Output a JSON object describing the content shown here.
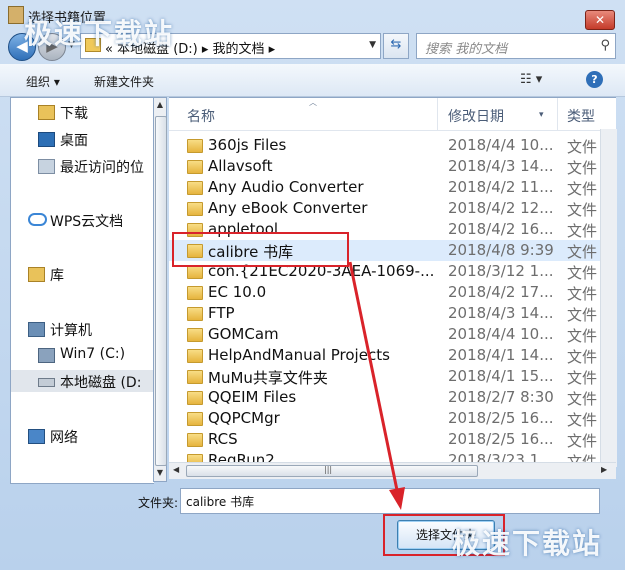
{
  "window": {
    "title": "选择书籍位置",
    "close_glyph": "✕"
  },
  "nav": {
    "back_glyph": "◀",
    "forward_glyph": "▶"
  },
  "address": {
    "crumbs": "« 本地磁盘 (D:) ▸ 我的文档 ▸",
    "dropdown": "▼"
  },
  "search": {
    "placeholder": "搜索 我的文档",
    "icon": "search-icon"
  },
  "toolbar": {
    "organize": "组织 ▾",
    "new_folder": "新建文件夹",
    "view_glyph": "☷ ▾",
    "help_glyph": "?"
  },
  "sidebar": {
    "items": [
      {
        "label": "下载",
        "icon": "download-folder-icon"
      },
      {
        "label": "桌面",
        "icon": "desktop-icon"
      },
      {
        "label": "最近访问的位",
        "icon": "recent-places-icon"
      },
      {
        "label": "WPS云文档",
        "icon": "cloud-icon"
      },
      {
        "label": "库",
        "icon": "library-icon"
      },
      {
        "label": "计算机",
        "icon": "computer-icon"
      },
      {
        "label": "Win7 (C:)",
        "icon": "system-drive-icon"
      },
      {
        "label": "本地磁盘 (D:",
        "icon": "drive-icon"
      },
      {
        "label": "网络",
        "icon": "network-icon"
      }
    ]
  },
  "columns": {
    "name": "名称",
    "date": "修改日期",
    "type": "类型"
  },
  "files": [
    {
      "name": "360js Files",
      "date": "2018/4/4 10...",
      "type": "文件"
    },
    {
      "name": "Allavsoft",
      "date": "2018/4/3 14...",
      "type": "文件"
    },
    {
      "name": "Any Audio Converter",
      "date": "2018/4/2 11...",
      "type": "文件"
    },
    {
      "name": "Any eBook Converter",
      "date": "2018/4/2 12...",
      "type": "文件"
    },
    {
      "name": "appletool",
      "date": "2018/4/2 16...",
      "type": "文件"
    },
    {
      "name": "calibre 书库",
      "date": "2018/4/8 9:39",
      "type": "文件"
    },
    {
      "name": "con.{21EC2020-3AEA-1069-...",
      "date": "2018/3/12 1...",
      "type": "文件"
    },
    {
      "name": "EC 10.0",
      "date": "2018/4/2 17...",
      "type": "文件"
    },
    {
      "name": "FTP",
      "date": "2018/4/3 14...",
      "type": "文件"
    },
    {
      "name": "GOMCam",
      "date": "2018/4/4 10...",
      "type": "文件"
    },
    {
      "name": "HelpAndManual Projects",
      "date": "2018/4/1 14...",
      "type": "文件"
    },
    {
      "name": "MuMu共享文件夹",
      "date": "2018/4/1 15...",
      "type": "文件"
    },
    {
      "name": "QQEIM Files",
      "date": "2018/2/7 8:30",
      "type": "文件"
    },
    {
      "name": "QQPCMgr",
      "date": "2018/2/5 16...",
      "type": "文件"
    },
    {
      "name": "RCS",
      "date": "2018/2/5 16...",
      "type": "文件"
    },
    {
      "name": "RegRun2",
      "date": "2018/3/23 1...",
      "type": "文件"
    }
  ],
  "selected_index": 5,
  "bottom": {
    "folder_label": "文件夹:",
    "folder_value": "calibre 书库",
    "select_button": "选择文件夹"
  },
  "watermarks": {
    "top": "极速下载站",
    "bottom": "极速下载站"
  },
  "colors": {
    "highlight_red": "#d9232a",
    "selection_blue": "#dcebfc",
    "link_blue": "#2f6fb8"
  }
}
